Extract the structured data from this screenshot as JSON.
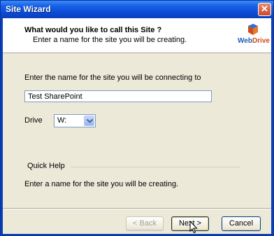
{
  "window": {
    "title": "Site Wizard",
    "close_glyph": "✕"
  },
  "header": {
    "title": "What would you like to call this Site ?",
    "subtitle": "Enter a name for the site you will be creating.",
    "logo_text_a": "Web",
    "logo_text_b": "Drive",
    "logo_icon": "webdrive-logo-icon"
  },
  "form": {
    "site_label": "Enter the name for the site you will be connecting to",
    "site_value": "Test SharePoint",
    "drive_label": "Drive",
    "drive_value": "W:"
  },
  "quick_help": {
    "title": "Quick Help",
    "text": "Enter a name for the site you will be creating."
  },
  "buttons": {
    "back": "< Back",
    "next": "Next >",
    "cancel": "Cancel"
  },
  "colors": {
    "titlebar": "#0a4bd6",
    "dialog_bg": "#ece9d8",
    "logo_orange": "#d04a1a",
    "logo_blue": "#1c5cb8"
  }
}
